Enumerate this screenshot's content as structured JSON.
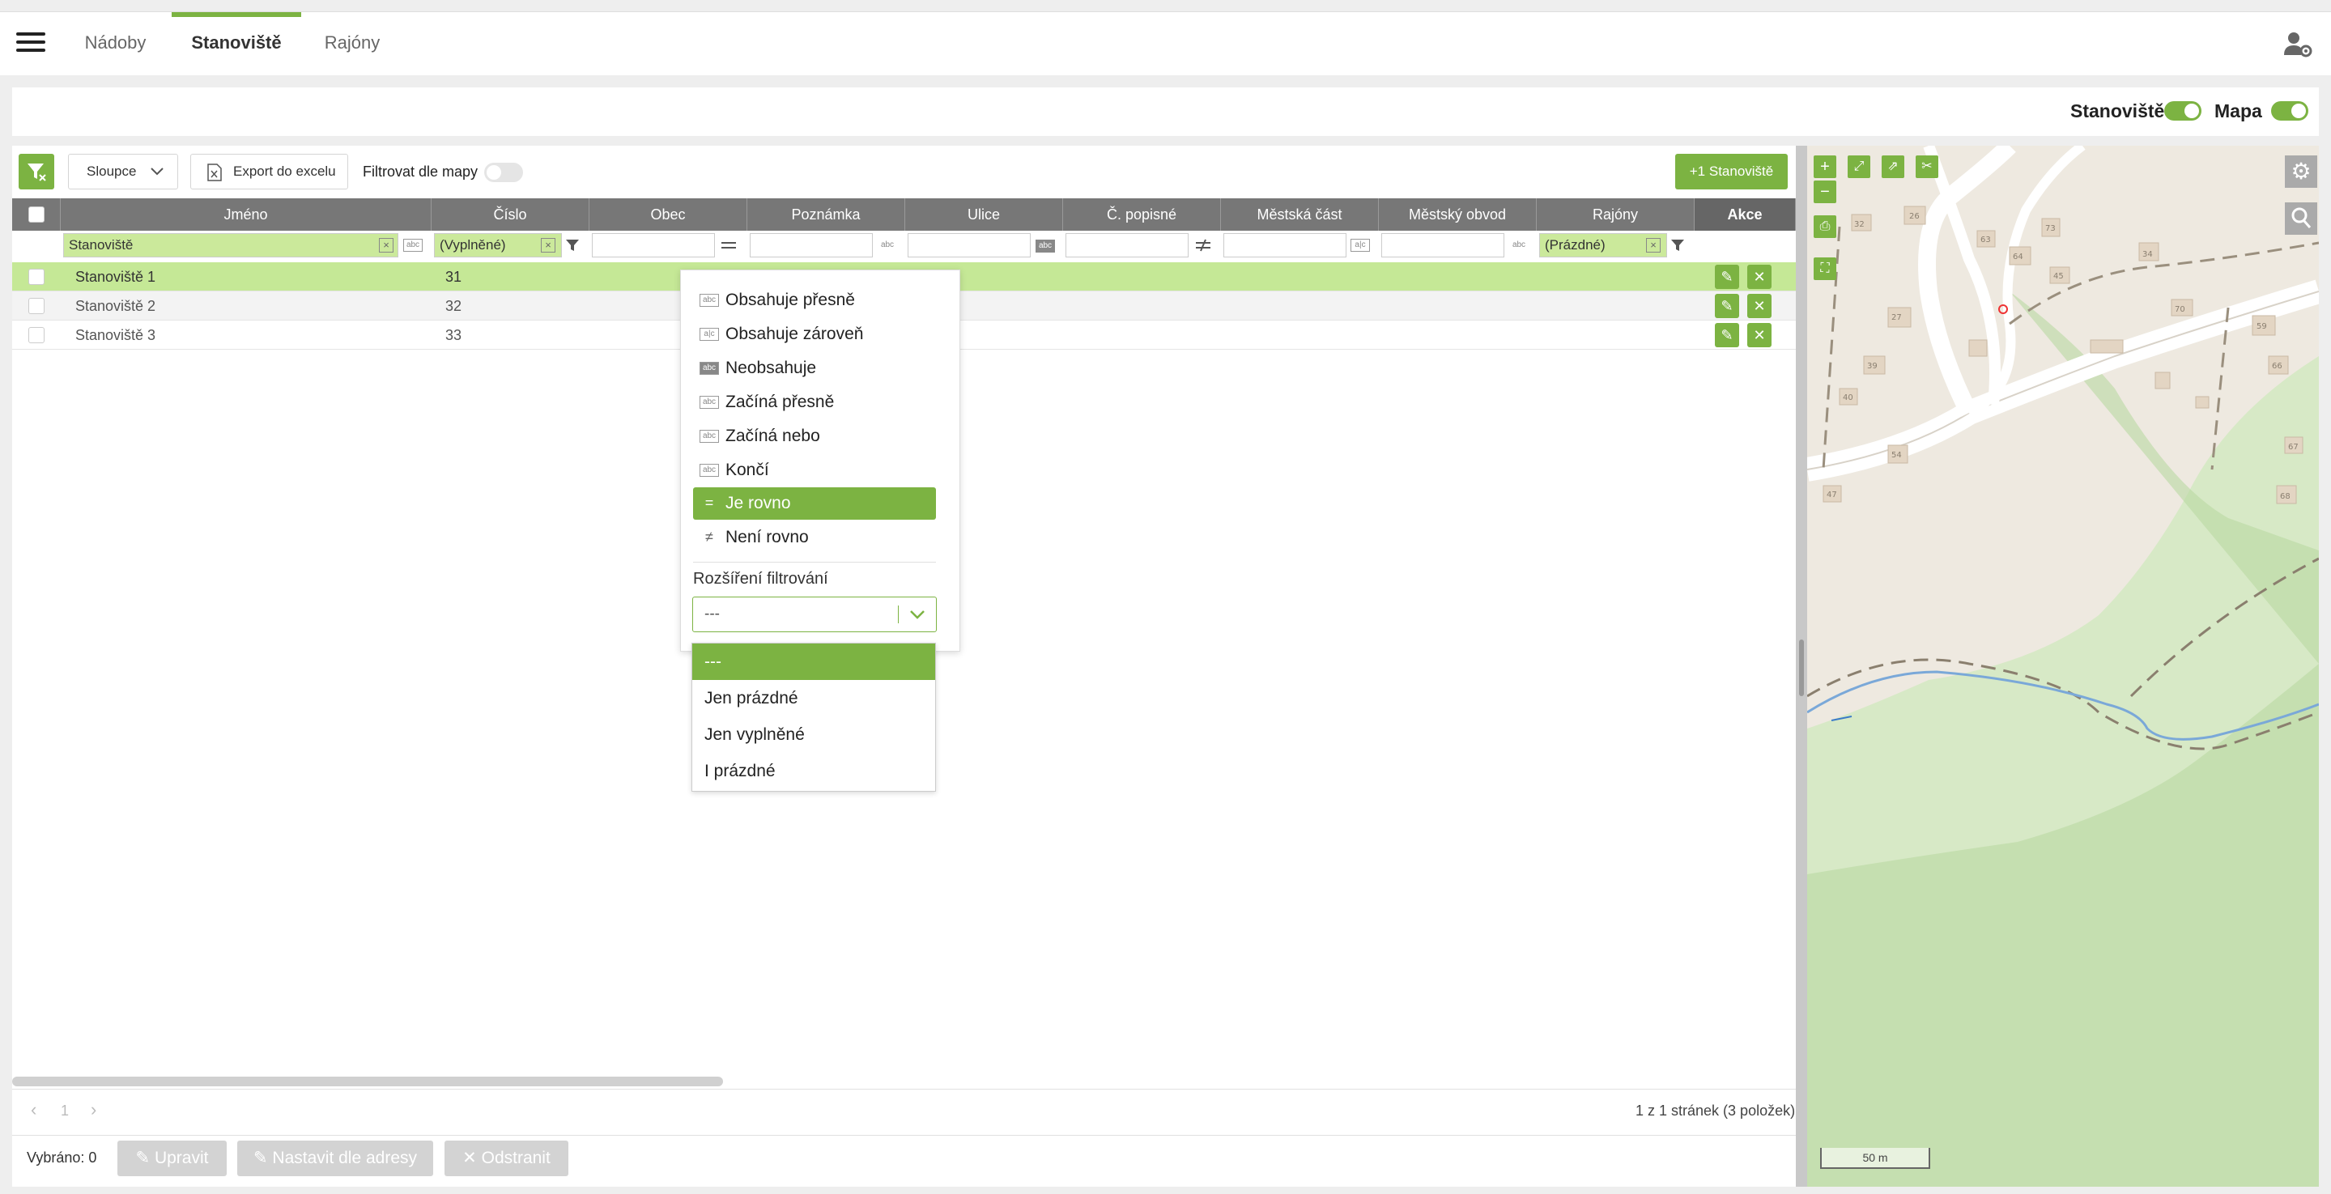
{
  "nav": {
    "tabs": [
      {
        "label": "Nádoby"
      },
      {
        "label": "Stanoviště"
      },
      {
        "label": "Rajóny"
      }
    ]
  },
  "toggles": {
    "sites_label": "Stanoviště",
    "map_label": "Mapa"
  },
  "toolbar": {
    "columns_label": "Sloupce",
    "export_label": "Export do excelu",
    "filter_map_label": "Filtrovat dle mapy",
    "add_label": "+1 Stanoviště"
  },
  "table": {
    "headers": [
      "Jméno",
      "Číslo",
      "Obec",
      "Poznámka",
      "Ulice",
      "Č. popisné",
      "Městská část",
      "Městský obvod",
      "Rajóny",
      "Akce"
    ],
    "filters": {
      "name": "Stanoviště",
      "number": "(Vyplněné)",
      "districts": "(Prázdné)"
    },
    "rows": [
      {
        "name": "Stanoviště 1",
        "number": "31"
      },
      {
        "name": "Stanoviště 2",
        "number": "32"
      },
      {
        "name": "Stanoviště 3",
        "number": "33"
      }
    ]
  },
  "filter_menu": {
    "items": [
      "Obsahuje přesně",
      "Obsahuje zároveň",
      "Neobsahuje",
      "Začíná přesně",
      "Začíná nebo",
      "Končí",
      "Je rovno",
      "Není rovno"
    ],
    "selected": "Je rovno",
    "extension_label": "Rozšíření filtrování",
    "extension_value": "---",
    "options": [
      "---",
      "Jen prázdné",
      "Jen vyplněné",
      "I prázdné"
    ]
  },
  "pager": {
    "page": "1",
    "summary": "1 z 1 stránek (3 položek)"
  },
  "footer": {
    "selected": "Vybráno: 0",
    "edit": "Upravit",
    "set_address": "Nastavit dle adresy",
    "delete": "Odstranit"
  },
  "map": {
    "scale": "50 m",
    "house_numbers": [
      "32",
      "26",
      "63",
      "73",
      "64",
      "45",
      "27",
      "39",
      "40",
      "54",
      "47",
      "59",
      "66",
      "67",
      "68",
      "70",
      "34"
    ]
  },
  "colors": {
    "accent": "#7cb342",
    "header": "#777777"
  }
}
